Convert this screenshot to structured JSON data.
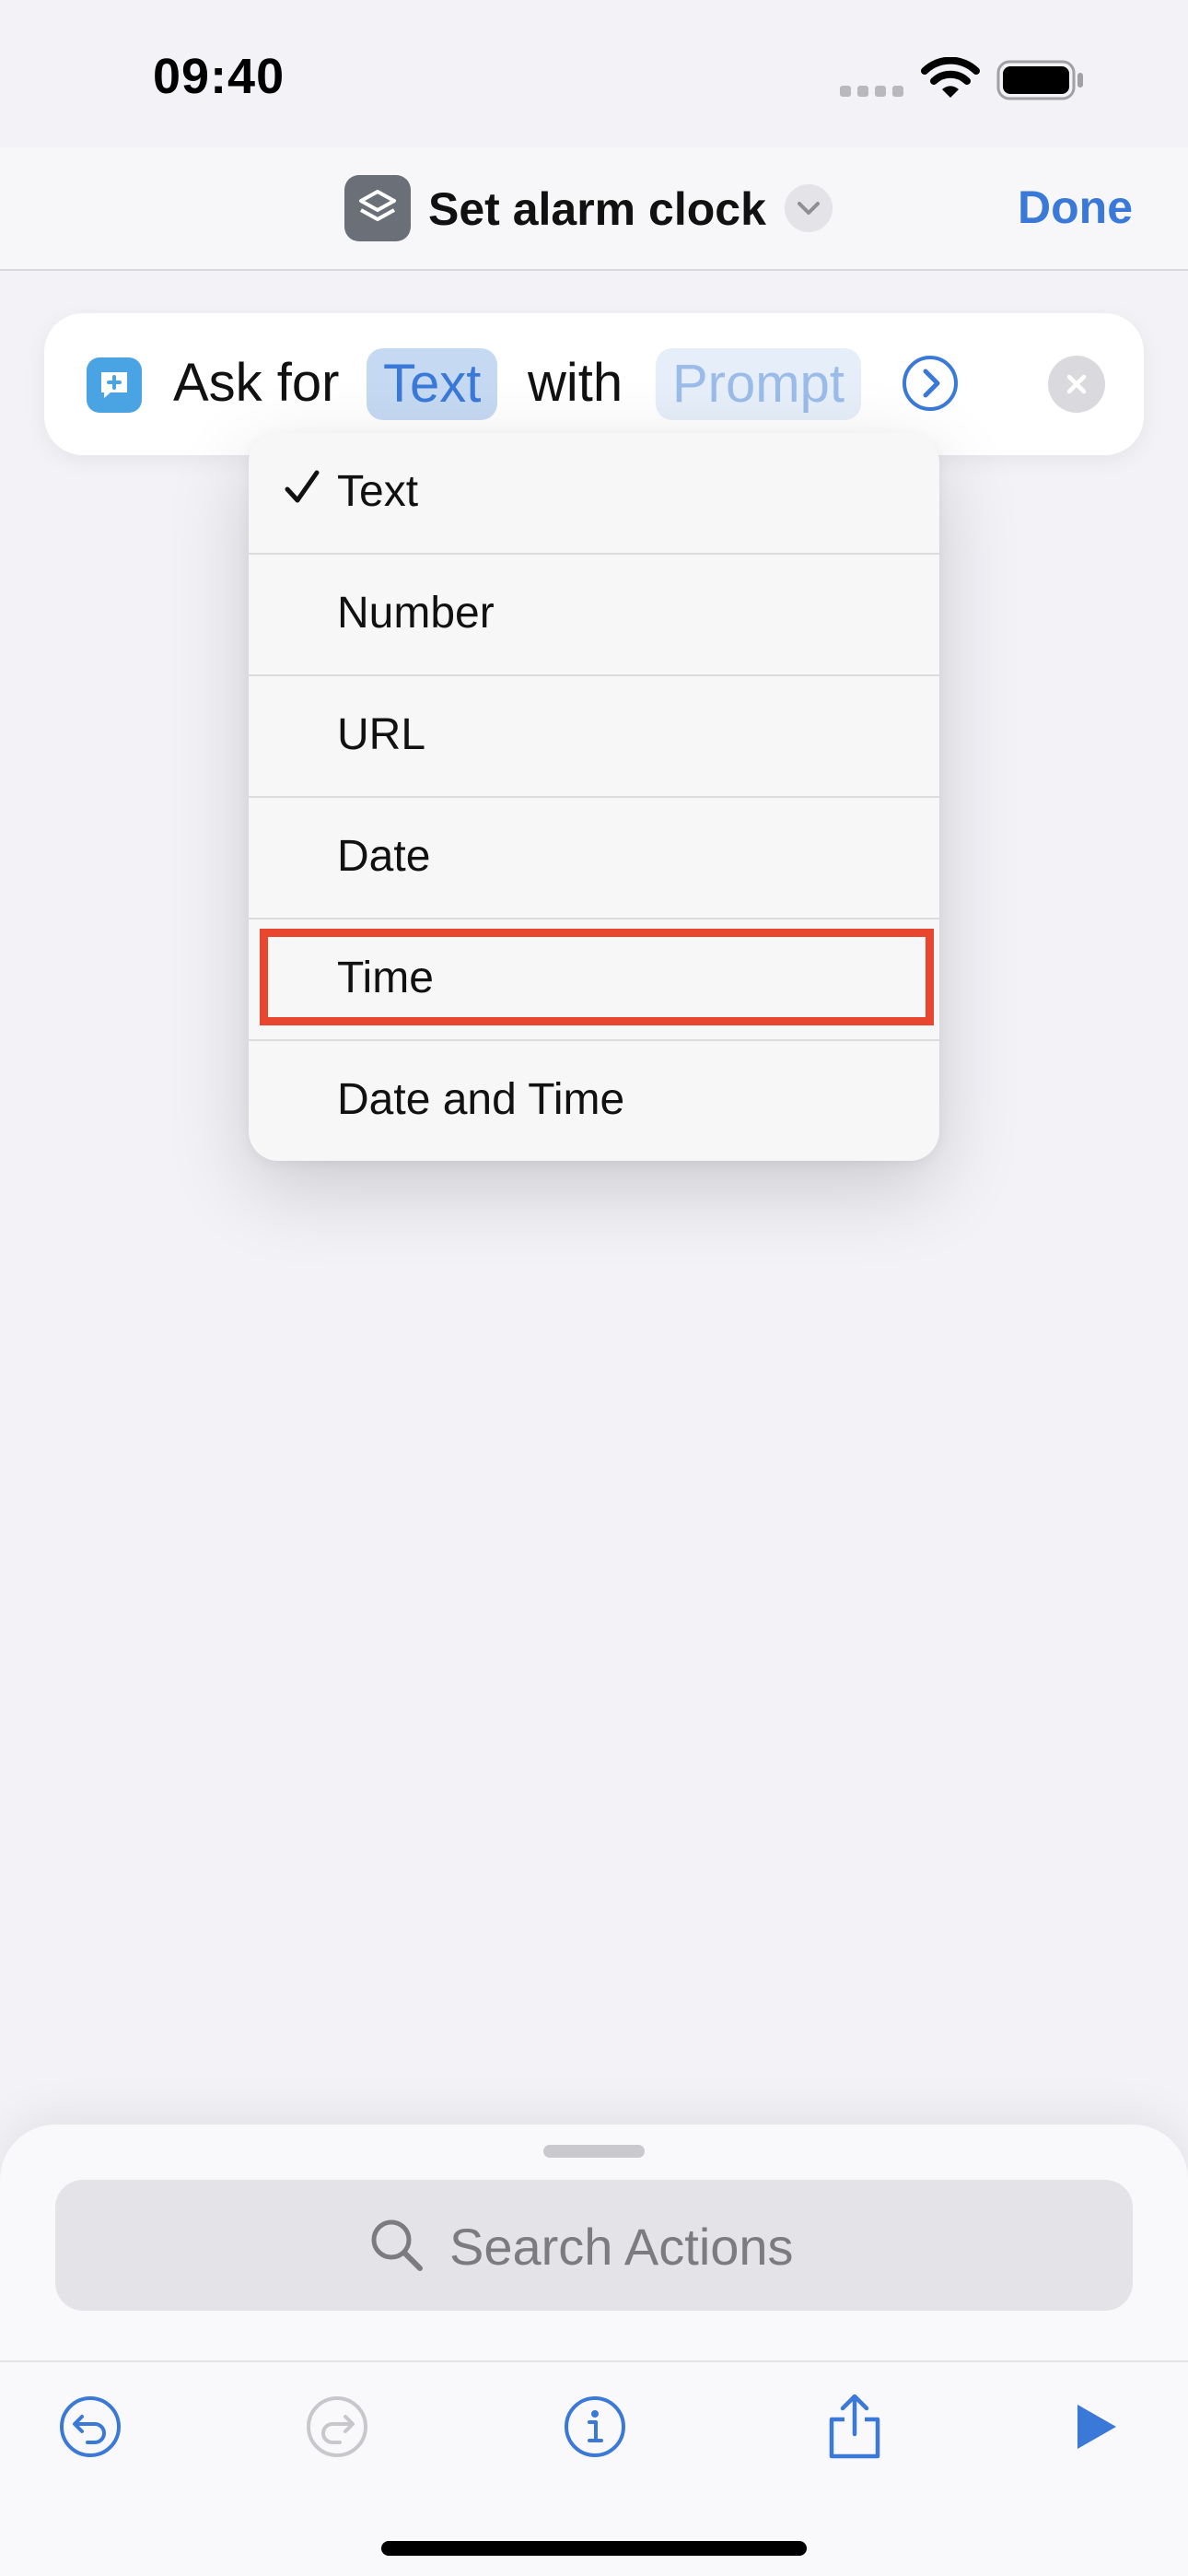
{
  "status_bar": {
    "time": "09:40"
  },
  "header": {
    "title": "Set alarm clock",
    "done_label": "Done",
    "app_icon": "shortcuts-icon"
  },
  "action": {
    "ask_for": "Ask for",
    "type_token": "Text",
    "with": "with",
    "prompt_token": "Prompt"
  },
  "type_menu": {
    "items": [
      {
        "label": "Text",
        "selected": true
      },
      {
        "label": "Number",
        "selected": false
      },
      {
        "label": "URL",
        "selected": false
      },
      {
        "label": "Date",
        "selected": false
      },
      {
        "label": "Time",
        "selected": false
      },
      {
        "label": "Date and Time",
        "selected": false
      }
    ],
    "highlighted_item": "Time"
  },
  "search": {
    "placeholder": "Search Actions"
  },
  "toolbar": {
    "icons": [
      "undo-icon",
      "redo-icon",
      "info-icon",
      "share-icon",
      "play-icon"
    ]
  },
  "colors": {
    "accent": "#3a79d8",
    "highlight_box": "#e8462f",
    "background": "#f2f2f7"
  }
}
